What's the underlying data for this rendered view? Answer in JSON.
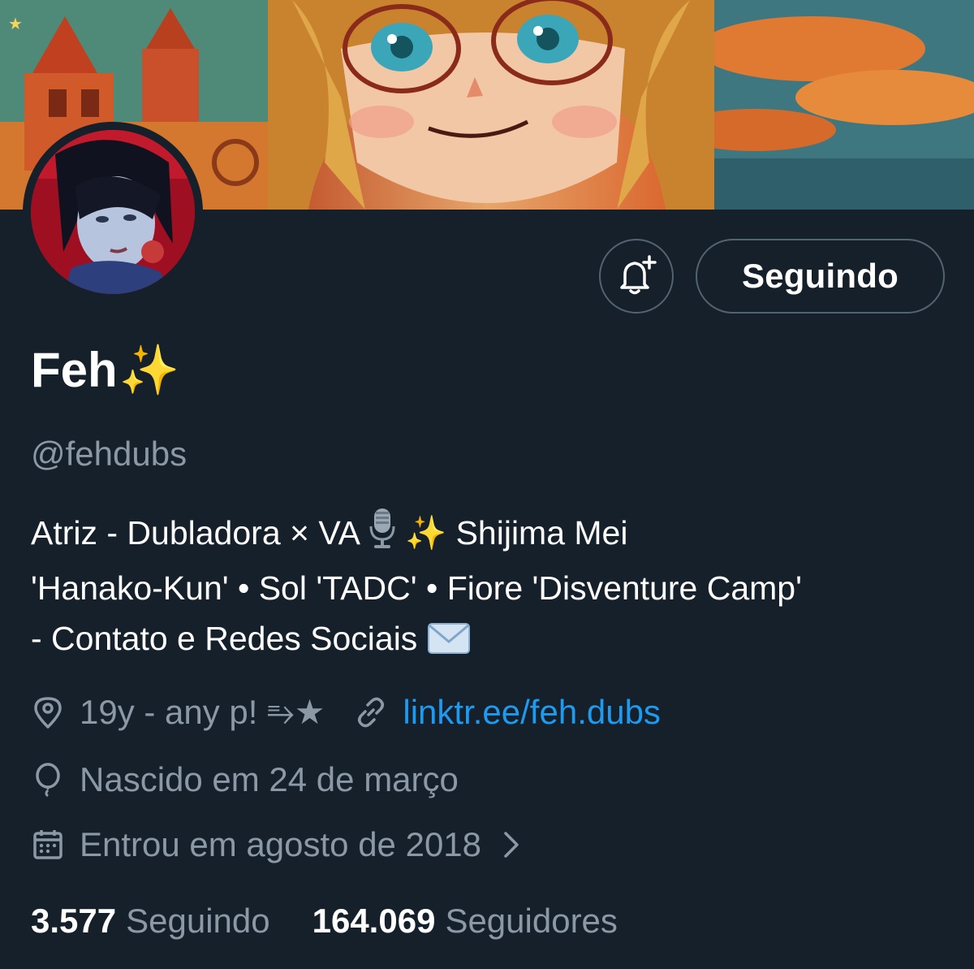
{
  "profile": {
    "display_name": "Feh",
    "name_emoji": "✨",
    "handle": "@fehdubs",
    "bio_lines": [
      "Atriz - Dubladora × VA ",
      "'Hanako-Kun' • Sol 'TADC' • Fiore 'Disventure Camp'",
      "- Contato e Redes Sociais "
    ],
    "bio_line1_tail": " Shijima Mei",
    "location": "19y - any p! ⥱★",
    "link": "linktr.ee/feh.dubs",
    "birthday": "Nascido em 24 de março",
    "joined": "Entrou em agosto de 2018"
  },
  "actions": {
    "notify_icon": "bell-plus-icon",
    "follow_state_label": "Seguindo"
  },
  "stats": {
    "following_count": "3.577",
    "following_label": "Seguindo",
    "followers_count": "164.069",
    "followers_label": "Seguidores"
  },
  "colors": {
    "background": "#15202b",
    "secondary_text": "#8b98a5",
    "link": "#1d9bf0",
    "border": "#536471"
  }
}
